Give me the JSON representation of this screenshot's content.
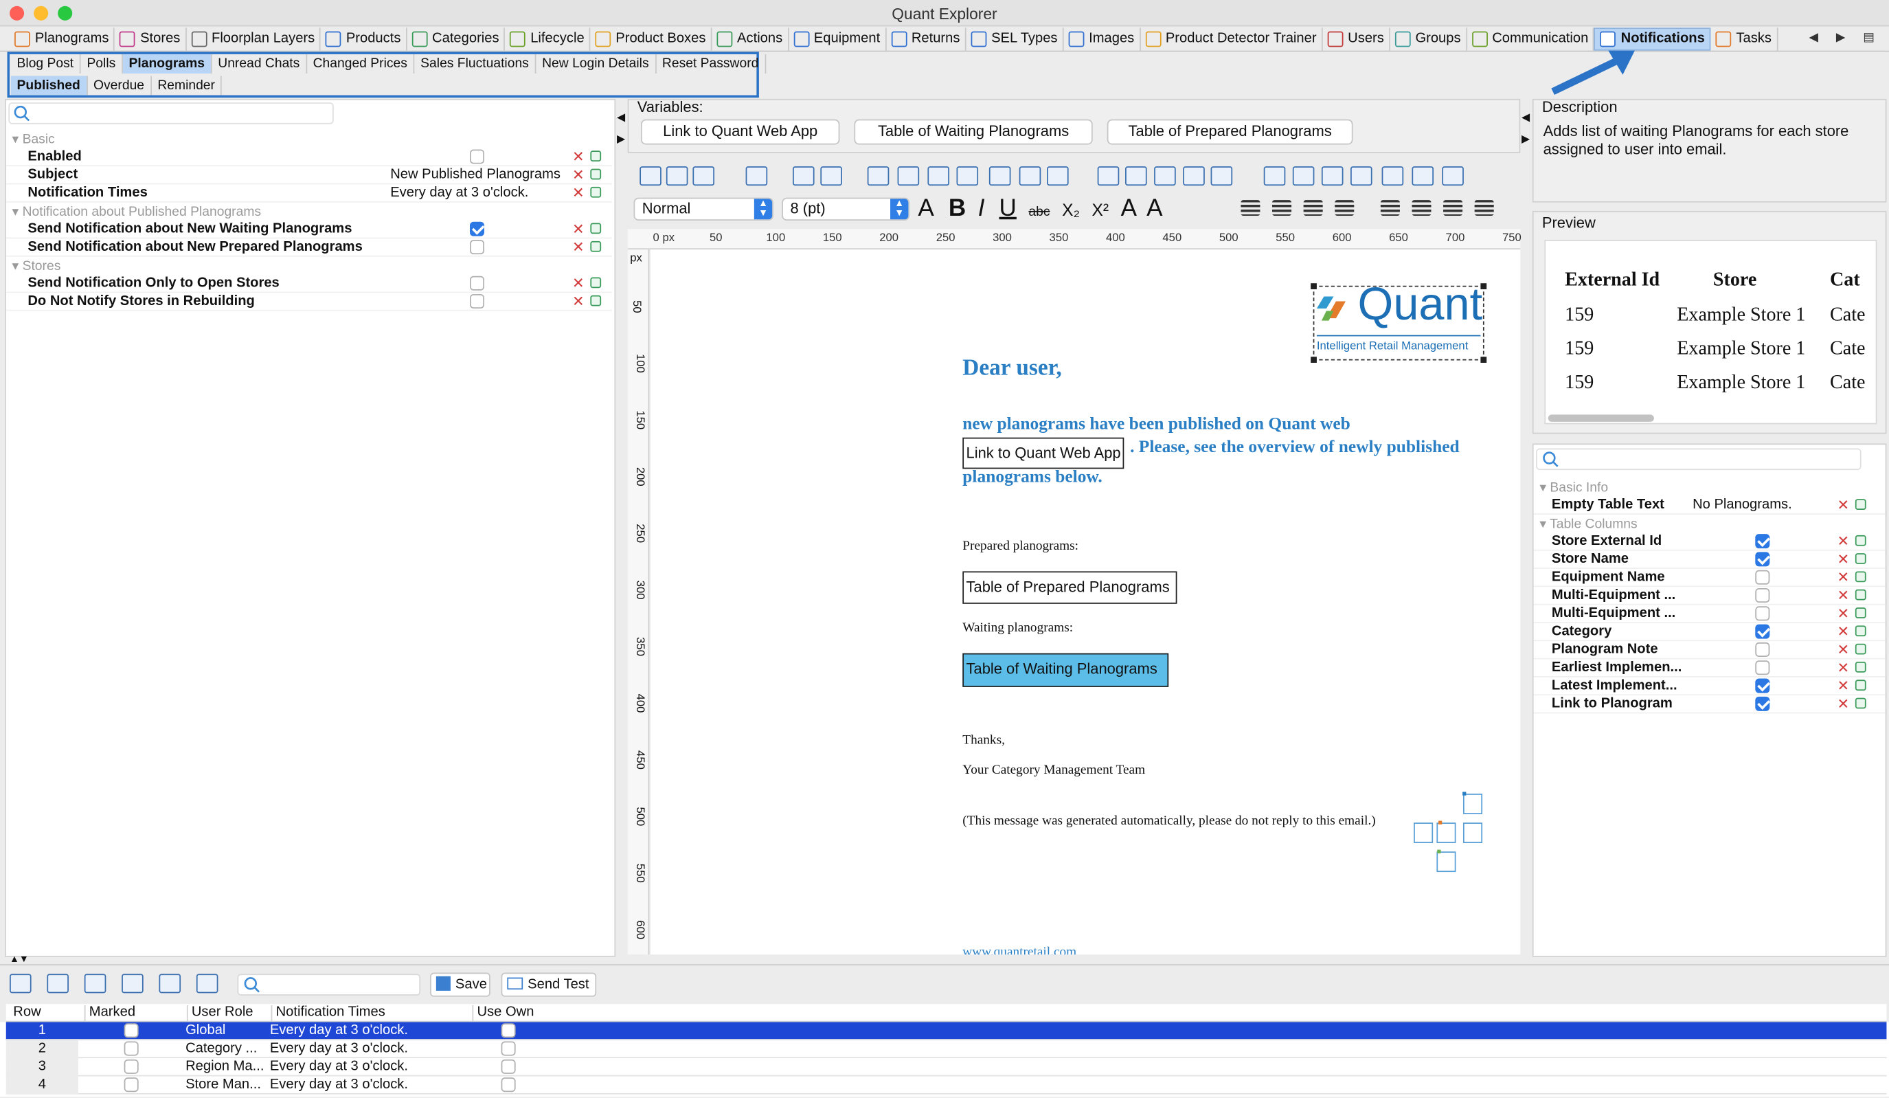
{
  "window": {
    "title": "Quant Explorer"
  },
  "main_tabs": [
    {
      "label": "Planograms",
      "icon": "planograms-icon",
      "color": "#e07a2a"
    },
    {
      "label": "Stores",
      "icon": "cart-icon",
      "color": "#c13a8a"
    },
    {
      "label": "Floorplan Layers",
      "icon": "layers-icon",
      "color": "#666666"
    },
    {
      "label": "Products",
      "icon": "products-icon",
      "color": "#2f6fd0"
    },
    {
      "label": "Categories",
      "icon": "categories-icon",
      "color": "#3a9a5a"
    },
    {
      "label": "Lifecycle",
      "icon": "lifecycle-icon",
      "color": "#6aa02a"
    },
    {
      "label": "Product Boxes",
      "icon": "boxes-icon",
      "color": "#e0a020"
    },
    {
      "label": "Actions",
      "icon": "actions-icon",
      "color": "#3a9a5a"
    },
    {
      "label": "Equipment",
      "icon": "equipment-icon",
      "color": "#2f6fd0"
    },
    {
      "label": "Returns",
      "icon": "returns-icon",
      "color": "#2f6fd0"
    },
    {
      "label": "SEL Types",
      "icon": "tag-icon",
      "color": "#2f6fd0"
    },
    {
      "label": "Images",
      "icon": "images-icon",
      "color": "#2f6fd0"
    },
    {
      "label": "Product Detector Trainer",
      "icon": "trainer-icon",
      "color": "#e0a020"
    },
    {
      "label": "Users",
      "icon": "users-icon",
      "color": "#c13a3a"
    },
    {
      "label": "Groups",
      "icon": "groups-icon",
      "color": "#3a9a9a"
    },
    {
      "label": "Communication",
      "icon": "envelope-icon",
      "color": "#6aa02a"
    },
    {
      "label": "Notifications",
      "icon": "notifications-icon",
      "color": "#2f6fd0",
      "active": true
    },
    {
      "label": "Tasks",
      "icon": "tasks-icon",
      "color": "#e07a2a"
    }
  ],
  "sub_tabs": [
    "Blog Post",
    "Polls",
    "Planograms",
    "Unread Chats",
    "Changed Prices",
    "Sales Fluctuations",
    "New Login Details",
    "Reset Password"
  ],
  "sub_tabs_active": "Planograms",
  "sub_sub_tabs": [
    "Published",
    "Overdue",
    "Reminder"
  ],
  "properties": {
    "section_basic": "Basic",
    "enabled_label": "Enabled",
    "enabled": false,
    "subject_label": "Subject",
    "subject_value": "New Published Planograms",
    "times_label": "Notification Times",
    "times_value": "Every day at 3 o'clock.",
    "section_published": "Notification about Published Planograms",
    "waiting_label": "Send Notification about New Waiting Planograms",
    "waiting": true,
    "prepared_label": "Send Notification about New Prepared Planograms",
    "prepared": false,
    "section_stores": "Stores",
    "open_only_label": "Send Notification Only to Open Stores",
    "open_only": false,
    "rebuild_label": "Do Not Notify Stores in Rebuilding",
    "rebuild": false
  },
  "variables": {
    "title": "Variables:",
    "buttons": [
      "Link to Quant Web App",
      "Table of Waiting Planograms",
      "Table of Prepared Planograms"
    ]
  },
  "editor": {
    "style_select": "Normal",
    "size_select": "8 (pt)",
    "ruler_unit": "px",
    "ruler_ticks": [
      "0 px",
      "50",
      "100",
      "150",
      "200",
      "250",
      "300",
      "350",
      "400",
      "450",
      "500",
      "550",
      "600",
      "650",
      "700",
      "750"
    ],
    "v_ruler_ticks": [
      "50",
      "100",
      "150",
      "200",
      "250",
      "300",
      "350",
      "400",
      "450",
      "500",
      "550",
      "600"
    ],
    "logo_text": "Quant",
    "logo_tagline": "Intelligent Retail Management",
    "greeting": "Dear user,",
    "intro_1": "new planograms have been published on Quant web",
    "link_box": "Link to Quant Web App",
    "intro_2": ". Please, see the overview of newly published",
    "intro_3": "planograms below.",
    "prepared_heading": "Prepared planograms:",
    "prepared_box": "Table of Prepared Planograms",
    "waiting_heading": "Waiting planograms:",
    "waiting_box": "Table of Waiting Planograms",
    "thanks": "Thanks,",
    "signature": "Your Category Management Team",
    "auto_note": "(This message was generated automatically, please do not reply to this email.)",
    "footer_link": "www.quantretail.com"
  },
  "description": {
    "title": "Description",
    "text": "Adds list of waiting Planograms for each store assigned to user into email."
  },
  "preview": {
    "title": "Preview",
    "headers": [
      "External Id",
      "Store",
      "Cat"
    ],
    "rows": [
      [
        "159",
        "Example Store 1",
        "Cate"
      ],
      [
        "159",
        "Example Store 1",
        "Cate"
      ],
      [
        "159",
        "Example Store 1",
        "Cate"
      ]
    ]
  },
  "table_props": {
    "section_basic": "Basic Info",
    "empty_label": "Empty Table Text",
    "empty_value": "No Planograms.",
    "section_columns": "Table Columns",
    "columns": [
      {
        "label": "Store External Id",
        "checked": true
      },
      {
        "label": "Store Name",
        "checked": true
      },
      {
        "label": "Equipment Name",
        "checked": false
      },
      {
        "label": "Multi-Equipment ...",
        "checked": false
      },
      {
        "label": "Multi-Equipment ...",
        "checked": false
      },
      {
        "label": "Category",
        "checked": true
      },
      {
        "label": "Planogram Note",
        "checked": false
      },
      {
        "label": "Earliest Implemen...",
        "checked": false
      },
      {
        "label": "Latest Implement...",
        "checked": true
      },
      {
        "label": "Link to Planogram",
        "checked": true
      }
    ]
  },
  "bottom": {
    "save_label": "Save",
    "send_test_label": "Send Test",
    "headers": [
      "Row",
      "Marked",
      "User Role",
      "Notification Times",
      "Use Own"
    ],
    "rows": [
      {
        "row": "1",
        "role": "Global",
        "times": "Every day at 3 o'clock.",
        "selected": true
      },
      {
        "row": "2",
        "role": "Category ...",
        "times": "Every day at 3 o'clock."
      },
      {
        "row": "3",
        "role": "Region Ma...",
        "times": "Every day at 3 o'clock."
      },
      {
        "row": "4",
        "role": "Store Man...",
        "times": "Every day at 3 o'clock."
      }
    ]
  },
  "colors": {
    "accent": "#2a73c7",
    "selection": "#1f47d6",
    "email_blue": "#2a7fc4",
    "logo_blue": "#1c6eb5"
  }
}
